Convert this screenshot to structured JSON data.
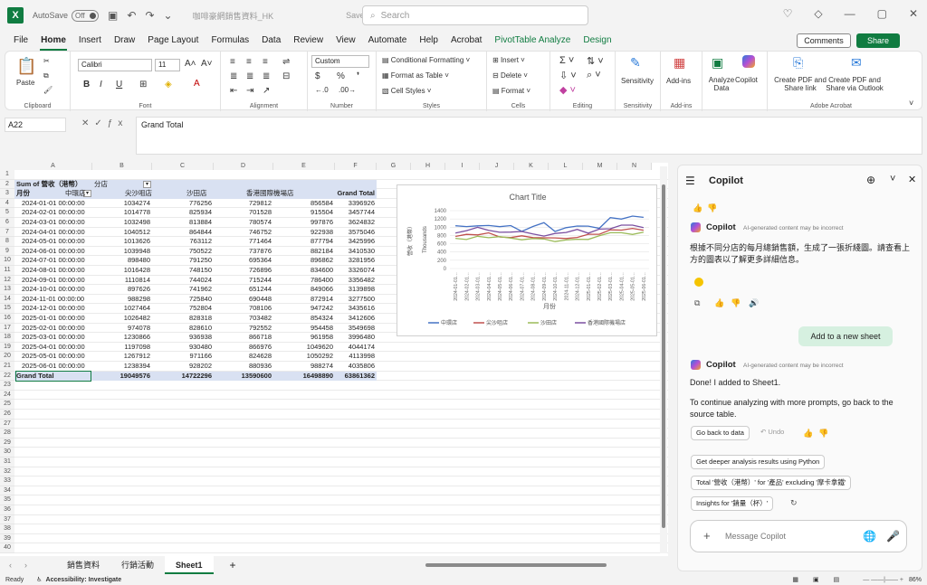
{
  "titlebar": {
    "autosave": "AutoSave",
    "toggle": "Off",
    "doc_name": "咖啡豪網銷售資料_HK",
    "saved": "Saved",
    "search_placeholder": "Search"
  },
  "menu": {
    "tabs": [
      "File",
      "Home",
      "Insert",
      "Draw",
      "Page Layout",
      "Formulas",
      "Data",
      "Review",
      "View",
      "Automate",
      "Help",
      "Acrobat",
      "PivotTable Analyze",
      "Design"
    ],
    "comments": "Comments",
    "share": "Share"
  },
  "ribbon": {
    "paste": "Paste",
    "clipboard": "Clipboard",
    "font_name": "Calibri",
    "font_size": "11",
    "font_label": "Font",
    "alignment": "Alignment",
    "number_format": "Custom",
    "number": "Number",
    "cond_fmt": "Conditional Formatting",
    "fmt_table": "Format as Table",
    "cell_styles": "Cell Styles",
    "styles": "Styles",
    "insert": "Insert",
    "delete": "Delete",
    "format": "Format",
    "cells": "Cells",
    "editing": "Editing",
    "sensitivity": "Sensitivity",
    "sensitivity_label": "Sensitivity",
    "addins": "Add-ins",
    "addins_label": "Add-ins",
    "analyze": "Analyze Data",
    "copilot": "Copilot",
    "create_pdf_link": "Create PDF and Share link",
    "create_pdf_outlook": "Create PDF and Share via Outlook",
    "adobe": "Adobe Acrobat"
  },
  "formula": {
    "cell": "A22",
    "content": "Grand Total"
  },
  "columns": [
    "A",
    "B",
    "C",
    "D",
    "E",
    "F",
    "G",
    "H",
    "I",
    "J",
    "K",
    "L",
    "M",
    "N"
  ],
  "pivot": {
    "title": "Sum of 營收（港幣）",
    "col_field": "分店",
    "row_field": "月份",
    "headers": [
      "中環店",
      "尖沙咀店",
      "沙田店",
      "香港國際機場店",
      "Grand Total"
    ],
    "rows": [
      [
        "2024-01-01 00:00:00",
        "1034274",
        "776256",
        "729812",
        "856584",
        "3396926"
      ],
      [
        "2024-02-01 00:00:00",
        "1014778",
        "825934",
        "701528",
        "915504",
        "3457744"
      ],
      [
        "2024-03-01 00:00:00",
        "1032498",
        "813884",
        "780574",
        "997876",
        "3624832"
      ],
      [
        "2024-04-01 00:00:00",
        "1040512",
        "864844",
        "746752",
        "922938",
        "3575046"
      ],
      [
        "2024-05-01 00:00:00",
        "1013626",
        "763112",
        "771464",
        "877794",
        "3425996"
      ],
      [
        "2024-06-01 00:00:00",
        "1039948",
        "750522",
        "737876",
        "882184",
        "3410530"
      ],
      [
        "2024-07-01 00:00:00",
        "898480",
        "791250",
        "695364",
        "896862",
        "3281956"
      ],
      [
        "2024-08-01 00:00:00",
        "1016428",
        "748150",
        "726896",
        "834600",
        "3326074"
      ],
      [
        "2024-09-01 00:00:00",
        "1110814",
        "744024",
        "715244",
        "786400",
        "3356482"
      ],
      [
        "2024-10-01 00:00:00",
        "897626",
        "741962",
        "651244",
        "849066",
        "3139898"
      ],
      [
        "2024-11-01 00:00:00",
        "988298",
        "725840",
        "690448",
        "872914",
        "3277500"
      ],
      [
        "2024-12-01 00:00:00",
        "1027464",
        "752804",
        "708106",
        "947242",
        "3435616"
      ],
      [
        "2025-01-01 00:00:00",
        "1026482",
        "828318",
        "703482",
        "854324",
        "3412606"
      ],
      [
        "2025-02-01 00:00:00",
        "974078",
        "828610",
        "792552",
        "954458",
        "3549698"
      ],
      [
        "2025-03-01 00:00:00",
        "1230866",
        "936938",
        "866718",
        "961958",
        "3996480"
      ],
      [
        "2025-04-01 00:00:00",
        "1197098",
        "930480",
        "866976",
        "1049620",
        "4044174"
      ],
      [
        "2025-05-01 00:00:00",
        "1267912",
        "971166",
        "824628",
        "1050292",
        "4113998"
      ],
      [
        "2025-06-01 00:00:00",
        "1238394",
        "928202",
        "880936",
        "988274",
        "4035806"
      ]
    ],
    "total": [
      "Grand Total",
      "19049576",
      "14722296",
      "13590600",
      "16498890",
      "63861362"
    ]
  },
  "chart_data": {
    "type": "line",
    "title": "Chart Title",
    "xlabel": "月份",
    "ylabel": "營收（港幣）",
    "unit_label": "Thousands",
    "ylim": [
      0,
      1400
    ],
    "yticks": [
      0,
      200,
      400,
      600,
      800,
      1000,
      1200,
      1400
    ],
    "categories": [
      "2024-01-01",
      "2024-02-01",
      "2024-03-01",
      "2024-04-01",
      "2024-05-01",
      "2024-06-01",
      "2024-07-01",
      "2024-08-01",
      "2024-09-01",
      "2024-10-01",
      "2024-11-01",
      "2024-12-01",
      "2025-01-01",
      "2025-02-01",
      "2025-03-01",
      "2025-04-01",
      "2025-05-01",
      "2025-06-01"
    ],
    "category_labels": [
      "2024-01-01…",
      "2024-02-01…",
      "2024-03-01…",
      "2024-04-01…",
      "2024-05-01…",
      "2024-06-01…",
      "2024-07-01…",
      "2024-08-01…",
      "2024-09-01…",
      "2024-10-01…",
      "2024-11-01…",
      "2024-12-01…",
      "2025-01-01…",
      "2025-02-01…",
      "2025-03-01…",
      "2025-04-01…",
      "2025-05-01…",
      "2025-06-01…"
    ],
    "series": [
      {
        "name": "中環店",
        "color": "#4472c4",
        "values": [
          1034.274,
          1014.778,
          1032.498,
          1040.512,
          1013.626,
          1039.948,
          898.48,
          1016.428,
          1110.814,
          897.626,
          988.298,
          1027.464,
          1026.482,
          974.078,
          1230.866,
          1197.098,
          1267.912,
          1238.394
        ]
      },
      {
        "name": "尖沙咀店",
        "color": "#c0504d",
        "values": [
          776.256,
          825.934,
          813.884,
          864.844,
          763.112,
          750.522,
          791.25,
          748.15,
          744.024,
          741.962,
          725.84,
          752.804,
          828.318,
          828.61,
          936.938,
          930.48,
          971.166,
          928.202
        ]
      },
      {
        "name": "沙田店",
        "color": "#9bbb59",
        "values": [
          729.812,
          701.528,
          780.574,
          746.752,
          771.464,
          737.876,
          695.364,
          726.896,
          715.244,
          651.244,
          690.448,
          708.106,
          703.482,
          792.552,
          866.718,
          866.976,
          824.628,
          880.936
        ]
      },
      {
        "name": "香港國際機場店",
        "color": "#7a4fa0",
        "values": [
          856.584,
          915.504,
          997.876,
          922.938,
          877.794,
          882.184,
          896.862,
          834.6,
          786.4,
          849.066,
          872.914,
          947.242,
          854.324,
          954.458,
          961.958,
          1049.62,
          1050.292,
          988.274
        ]
      }
    ],
    "legend": "bottom"
  },
  "sheets": [
    "銷售資料",
    "行銷活動",
    "Sheet1"
  ],
  "status": {
    "ready": "Ready",
    "accessibility": "Accessibility: Investigate",
    "zoom": "86%"
  },
  "copilot": {
    "title": "Copilot",
    "name": "Copilot",
    "disclaimer": "AI-generated content may be incorrect",
    "msg1": "根據不同分店的每月總銷售額，生成了一張折綫圖。請查看上方的圖表以了解更多詳細信息。",
    "add_sheet": "Add to a new sheet",
    "msg2": "Done! I added  to Sheet1.",
    "msg3": "To continue analyzing with more prompts, go back to the source table.",
    "go_back": "Go back to data",
    "undo": "Undo",
    "suggestions": [
      "Get deeper analysis results using Python",
      "Total '營收（港幣）' for '產品' excluding '摩卡拿鐵'",
      "Insights for '銷量（杯）'"
    ],
    "input_placeholder": "Message Copilot"
  }
}
